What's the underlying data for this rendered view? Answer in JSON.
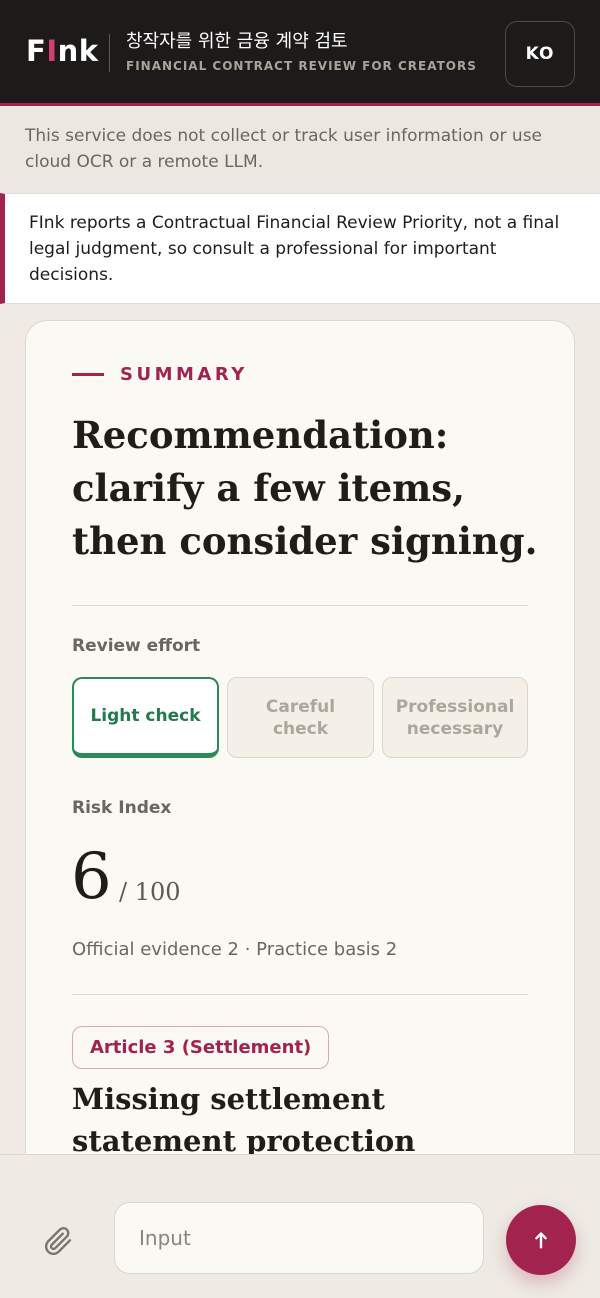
{
  "header": {
    "logo_first": "F",
    "logo_accent": "I",
    "logo_rest": "nk",
    "title_ko": "창작자를 위한 금융 계약 검토",
    "title_en": "FINANCIAL CONTRACT REVIEW FOR CREATORS",
    "language_label": "KO"
  },
  "notices": {
    "privacy": "This service does not collect or track user information or use cloud OCR or a remote LLM.",
    "disclaimer": "FInk reports a Contractual Financial Review Priority, not a final legal judgment, so consult a professional for important decisions."
  },
  "summary": {
    "eyebrow": "SUMMARY",
    "headline": "Recommendation: clarify a few items, then consider signing.",
    "review_effort_label": "Review effort",
    "effort_options": [
      {
        "label": "Light check",
        "selected": true
      },
      {
        "label": "Careful check",
        "selected": false
      },
      {
        "label": "Professional necessary",
        "selected": false
      }
    ],
    "risk_label": "Risk Index",
    "risk_value": "6",
    "risk_max": "/ 100",
    "evidence": "Official evidence 2 · Practice basis 2",
    "article_tag": "Article 3 (Settlement)",
    "article_title": "Missing settlement statement protection"
  },
  "composer": {
    "placeholder": "Input",
    "attach_icon": "paperclip-icon",
    "send_icon": "arrow-up-icon"
  },
  "colors": {
    "brand": "#a3234f",
    "header_bg": "#1d1b19",
    "page_bg": "#efebe4",
    "card_bg": "#fbf9f4",
    "selected_green": "#2b8a57"
  }
}
